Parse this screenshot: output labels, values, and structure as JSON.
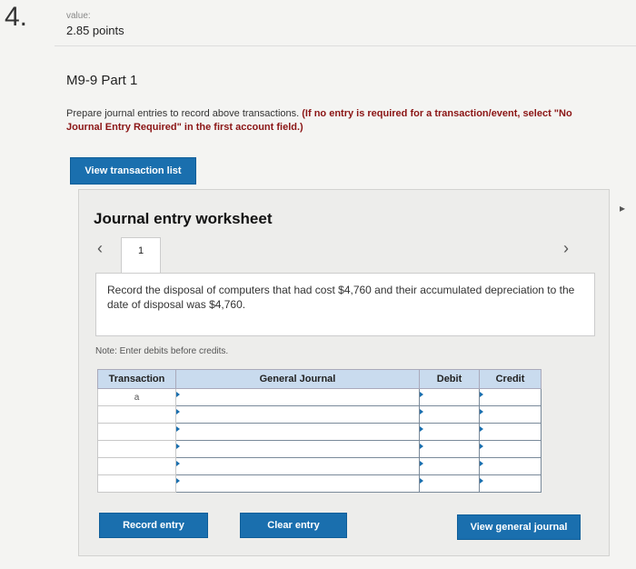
{
  "question": {
    "number": "4.",
    "value_label": "value:",
    "points": "2.85 points"
  },
  "part_title": "M9-9 Part 1",
  "instructions": {
    "text": "Prepare journal entries to record above transactions.",
    "emphasis": "(If no entry is required for a transaction/event, select \"No Journal Entry Required\" in the first account field.)"
  },
  "buttons": {
    "view_transaction_list": "View transaction list",
    "record_entry": "Record entry",
    "clear_entry": "Clear entry",
    "view_general_journal": "View general journal"
  },
  "worksheet": {
    "title": "Journal entry worksheet",
    "tab_label": "1",
    "prev_icon": "‹",
    "next_icon": "›",
    "description": "Record the disposal of computers that had cost $4,760 and their accumulated depreciation to the date of disposal was $4,760.",
    "note": "Note: Enter debits before credits."
  },
  "table": {
    "headers": [
      "Transaction",
      "General Journal",
      "Debit",
      "Credit"
    ],
    "rows": [
      {
        "transaction": "a",
        "account": "",
        "debit": "",
        "credit": ""
      },
      {
        "transaction": "",
        "account": "",
        "debit": "",
        "credit": ""
      },
      {
        "transaction": "",
        "account": "",
        "debit": "",
        "credit": ""
      },
      {
        "transaction": "",
        "account": "",
        "debit": "",
        "credit": ""
      },
      {
        "transaction": "",
        "account": "",
        "debit": "",
        "credit": ""
      },
      {
        "transaction": "",
        "account": "",
        "debit": "",
        "credit": ""
      }
    ]
  },
  "colors": {
    "accent": "#1a6fae",
    "emphasis": "#8b1515",
    "table_header": "#c9dbee"
  }
}
